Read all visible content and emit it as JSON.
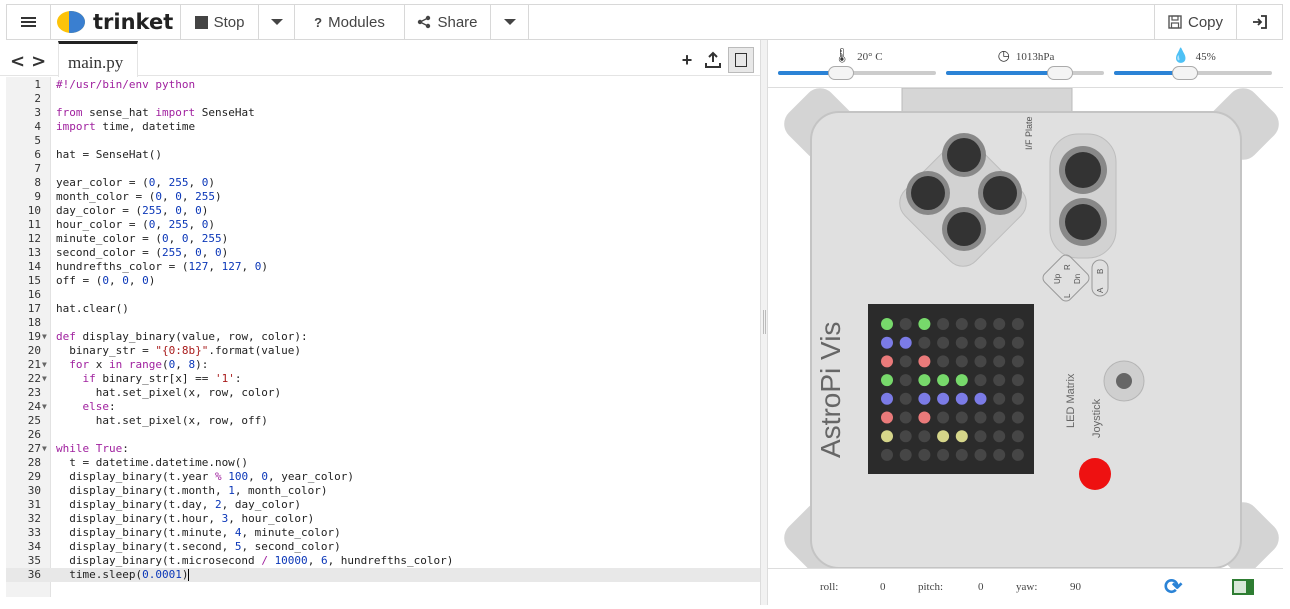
{
  "toolbar": {
    "brand": "trinket",
    "stop_label": "Stop",
    "modules_label": "Modules",
    "share_label": "Share",
    "copy_label": "Copy"
  },
  "editor": {
    "filename": "main.py",
    "active_line": 36,
    "folded_lines": [
      19,
      21,
      22,
      24,
      27
    ],
    "lines": [
      "#!/usr/bin/env python",
      "",
      "from sense_hat import SenseHat",
      "import time, datetime",
      "",
      "hat = SenseHat()",
      "",
      "year_color = (0, 255, 0)",
      "month_color = (0, 0, 255)",
      "day_color = (255, 0, 0)",
      "hour_color = (0, 255, 0)",
      "minute_color = (0, 0, 255)",
      "second_color = (255, 0, 0)",
      "hundrefths_color = (127, 127, 0)",
      "off = (0, 0, 0)",
      "",
      "hat.clear()",
      "",
      "def display_binary(value, row, color):",
      "  binary_str = \"{0:8b}\".format(value)",
      "  for x in range(0, 8):",
      "    if binary_str[x] == '1':",
      "      hat.set_pixel(x, row, color)",
      "    else:",
      "      hat.set_pixel(x, row, off)",
      "",
      "while True:",
      "  t = datetime.datetime.now()",
      "  display_binary(t.year % 100, 0, year_color)",
      "  display_binary(t.month, 1, month_color)",
      "  display_binary(t.day, 2, day_color)",
      "  display_binary(t.hour, 3, hour_color)",
      "  display_binary(t.minute, 4, minute_color)",
      "  display_binary(t.second, 5, second_color)",
      "  display_binary(t.microsecond / 10000, 6, hundrefths_color)",
      "  time.sleep(0.0001)"
    ]
  },
  "sensors": {
    "temperature": "20° C",
    "temperature_level": 0.4,
    "pressure": "1013hPa",
    "pressure_level": 0.72,
    "humidity": "45%",
    "humidity_level": 0.45
  },
  "board": {
    "name": "AstroPi Vis",
    "plate_label": "I/F Plate",
    "led_matrix_label": "LED Matrix",
    "joystick_label": "Joystick",
    "dpad_labels": [
      "Up",
      "R",
      "L",
      "Dn"
    ],
    "ab_labels": [
      "A",
      "B"
    ],
    "led_colors": {
      "G": "#77d96b",
      "B": "#7b7be6",
      "R": "#ea7a7a",
      "Y": "#d6d68a",
      "O": "#464646"
    },
    "led_rows": [
      "GOGOOOOO",
      "BBOOOOOO",
      "ROROOOOO",
      "GOGGGOOO",
      "BOBBBBOO",
      "ROROOOOO",
      "YOOYYOOO",
      "OOOOOOOO"
    ]
  },
  "orientation": {
    "roll_label": "roll:",
    "roll": "0",
    "pitch_label": "pitch:",
    "pitch": "0",
    "yaw_label": "yaw:",
    "yaw": "90"
  },
  "icons": {
    "menu": "hamburger-icon",
    "stop": "stop-icon",
    "modules": "question-icon",
    "share": "share-icon",
    "copy": "save-icon",
    "login": "login-icon",
    "add_file": "plus-icon",
    "upload": "upload-icon",
    "image": "image-icon",
    "refresh": "refresh-icon",
    "screen": "screen-icon"
  }
}
